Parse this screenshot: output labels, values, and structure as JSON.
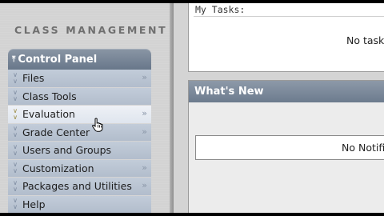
{
  "sidebar": {
    "section_title": "CLASS MANAGEMENT",
    "panel": {
      "label": "Control Panel",
      "caret_icon": "double-chevron-up-icon"
    },
    "items": [
      {
        "label": "Files",
        "expand": true
      },
      {
        "label": "Class Tools",
        "expand": false
      },
      {
        "label": "Evaluation",
        "expand": true,
        "hovered": true
      },
      {
        "label": "Grade Center",
        "expand": true
      },
      {
        "label": "Users and Groups",
        "expand": false
      },
      {
        "label": "Customization",
        "expand": true
      },
      {
        "label": "Packages and Utilities",
        "expand": true
      },
      {
        "label": "Help",
        "expand": false
      }
    ]
  },
  "main": {
    "tasks": {
      "title": "My Tasks:",
      "empty_text": "No task"
    },
    "whats_new": {
      "title": "What's New",
      "empty_text": "No Notifi"
    }
  },
  "colors": {
    "panel_header": "#6f7d90",
    "menu_item": "#b9c4d2",
    "menu_item_hover": "#e6ebf2",
    "content_bg": "#d4d4d4"
  }
}
